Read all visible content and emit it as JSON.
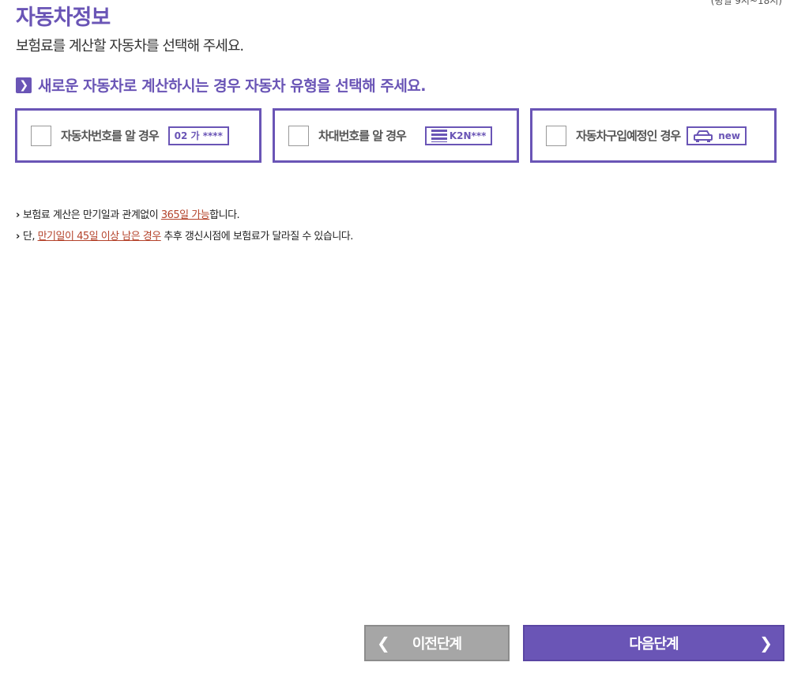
{
  "header": {
    "title": "자동차정보",
    "top_note": "(평일 9시~18시)",
    "subtitle": "보험료를 계산할 자동차를 선택해 주세요."
  },
  "section": {
    "heading": "새로운 자동차로 계산하시는 경우 자동차 유형을 선택해 주세요."
  },
  "options": [
    {
      "label": "자동차번호를 알 경우",
      "badge": "02 가 ****"
    },
    {
      "label": "차대번호를 알 경우",
      "badge": "K2N***"
    },
    {
      "label": "자동차구입예정인 경우",
      "badge": "new"
    }
  ],
  "notes": [
    {
      "marker": "›",
      "before": "보험료 계산은 만기일과 관계없이 ",
      "highlight": "365일 가능",
      "after": "합니다."
    },
    {
      "marker": "›",
      "before": "단, ",
      "highlight": "만기일이 45일 이상 남은 경우",
      "after": " 추후 갱신시점에 보험료가 달라질 수 있습니다."
    }
  ],
  "buttons": {
    "prev_label": "이전단계",
    "next_label": "다음단계"
  },
  "colors": {
    "accent": "#6a55b6",
    "highlight": "#b4432b",
    "prev_button": "#a6a6a6"
  }
}
